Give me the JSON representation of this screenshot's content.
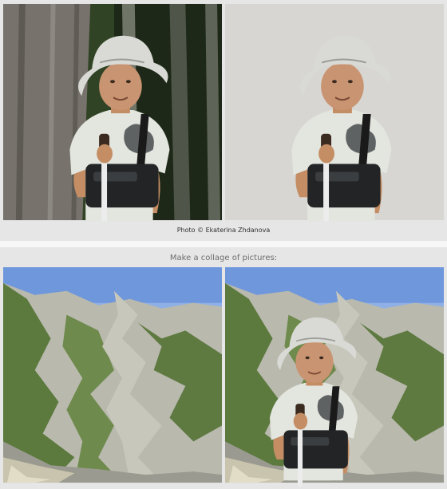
{
  "credit": "Photo © Ekaterina Zhdanova",
  "collage_title": "Make a collage of pictures:",
  "images": {
    "forest_original": "boy-in-forest-photo",
    "cutout": "boy-cutout-photo",
    "mountains": "mountain-landscape-photo",
    "collage": "collage-result-photo"
  }
}
